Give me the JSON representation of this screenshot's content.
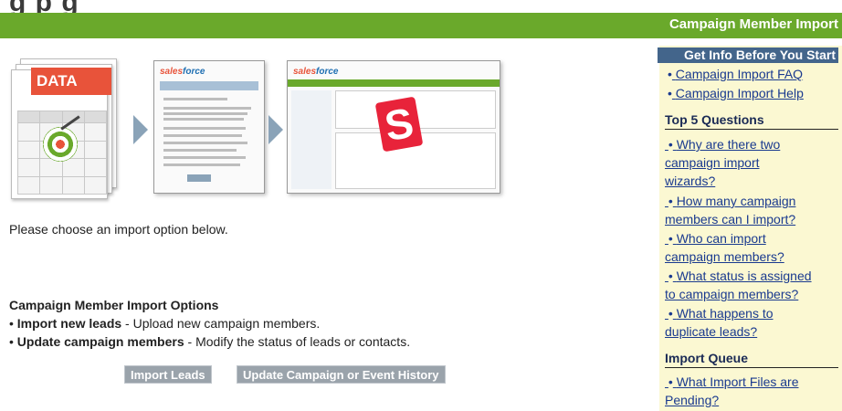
{
  "header": {
    "cutoff_text": "g    p        g",
    "title": "Campaign Member Import"
  },
  "illustration": {
    "data_label": "DATA",
    "logo_text_a": "sales",
    "logo_text_b": "force",
    "s_logo": "S"
  },
  "main": {
    "prompt": "Please choose an import option below.",
    "options_title": "Campaign Member Import Options",
    "options": [
      {
        "bullet": "•",
        "label": "Import new leads",
        "desc": " - Upload new campaign members."
      },
      {
        "bullet": "•",
        "label": "Update campaign members",
        "desc": " - Modify the status of leads or contacts."
      }
    ],
    "buttons": {
      "import_leads": "Import Leads",
      "update_history": "Update Campaign or Event History"
    }
  },
  "sidebar": {
    "get_info_title": "Get Info Before You Start",
    "info_links": [
      "Campaign Import FAQ",
      "Campaign Import Help"
    ],
    "top5_title": "Top 5 Questions",
    "questions": [
      {
        "line1": "Why are there two",
        "line2": "campaign import",
        "line3": "wizards?"
      },
      {
        "line1": "How many campaign",
        "line2": "members can I import?"
      },
      {
        "line1": "Who can import",
        "line2": "campaign members?"
      },
      {
        "line1": "What status is assigned",
        "line2": "to campaign members?"
      },
      {
        "line1": "What happens to",
        "line2": "duplicate leads?"
      }
    ],
    "queue_title": "Import Queue",
    "queue_link": {
      "line1": "What Import Files are",
      "line2": "Pending?"
    },
    "bullet": "•"
  },
  "colors": {
    "header_green": "#6aa92b",
    "sidebar_bg": "#fbf8d2",
    "sidebar_head_blue": "#43658b",
    "link_blue": "#1a3a8f",
    "button_gray": "#9aa3ab"
  }
}
